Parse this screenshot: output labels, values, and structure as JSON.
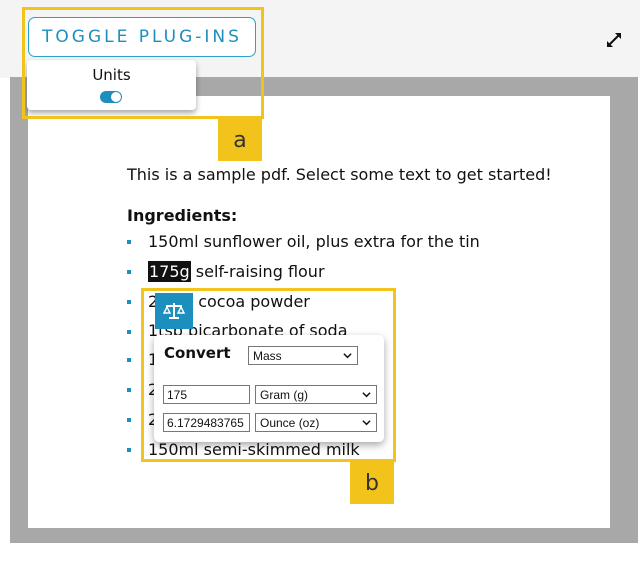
{
  "toolbar": {
    "toggle_label": "TOGGLE PLUG-INS",
    "expand_icon": "expand-icon"
  },
  "units_popup": {
    "label": "Units",
    "toggle_on": true
  },
  "annotations": {
    "a": "a",
    "b": "b",
    "highlight_color": "#f2c31b"
  },
  "document": {
    "intro": "This is a sample pdf. Select some text to get started!",
    "heading": "Ingredients:",
    "items": [
      {
        "selected": "",
        "text": "150ml sunflower oil, plus extra for the tin"
      },
      {
        "selected": "175g",
        "text": " self-raising flour"
      },
      {
        "selected": "",
        "text": "2tbsp cocoa powder"
      },
      {
        "selected": "",
        "text": "1tsp bicarbonate of soda"
      },
      {
        "selected": "",
        "text": "1"
      },
      {
        "selected": "",
        "text": "2"
      },
      {
        "selected": "",
        "text": "2"
      },
      {
        "selected": "",
        "text": "150ml semi-skimmed milk"
      }
    ]
  },
  "converter": {
    "icon": "scale-icon",
    "title": "Convert",
    "category": "Mass",
    "from_value": "175",
    "from_unit": "Gram (g)",
    "to_value": "6.1729483765",
    "to_unit": "Ounce (oz)"
  },
  "colors": {
    "accent": "#1d8fbf",
    "viewer_bg": "#a8a8a8"
  }
}
